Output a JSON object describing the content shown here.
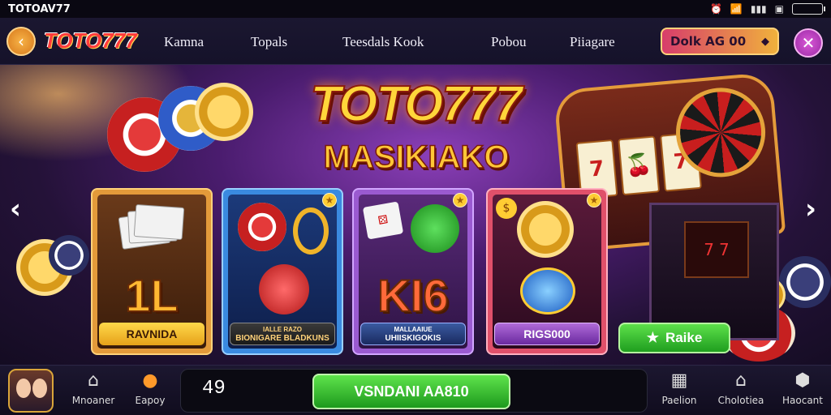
{
  "status_bar": {
    "app_name": "TOTOAV77"
  },
  "top_nav": {
    "logo": "TOTO777",
    "items": [
      "Kamna",
      "Topals",
      "Teesdals Kook",
      "Pobou",
      "Piiagare"
    ],
    "wallet_label": "Dolk",
    "wallet_value": "AG 00"
  },
  "hero": {
    "title": "TOTO777",
    "subtitle": "MASIKIAKO"
  },
  "cards": [
    {
      "big_text": "1L",
      "label": "RAVNIDA",
      "sublabel": ""
    },
    {
      "big_text": "",
      "label": "BIONIGARE BLADKUNS",
      "sublabel": "IALLE RAZO"
    },
    {
      "big_text": "KI6",
      "label": "UHIISKIGOKIS",
      "sublabel": "MALLAAIUE"
    },
    {
      "big_text": "",
      "label": "RIGS000",
      "sublabel": ""
    }
  ],
  "take_button": {
    "label": "Raike"
  },
  "bottom_bar": {
    "left_items": [
      "Mnoaner",
      "Eapoy"
    ],
    "bet_value": "49",
    "bet_button": "VSNDANI AA810",
    "right_items": [
      "Paelion",
      "Cholotiea",
      "Haocant"
    ]
  },
  "colors": {
    "accent_green": "#2fbf2a",
    "gold": "#ffc637",
    "purple_bg": "#4a1c6e"
  }
}
